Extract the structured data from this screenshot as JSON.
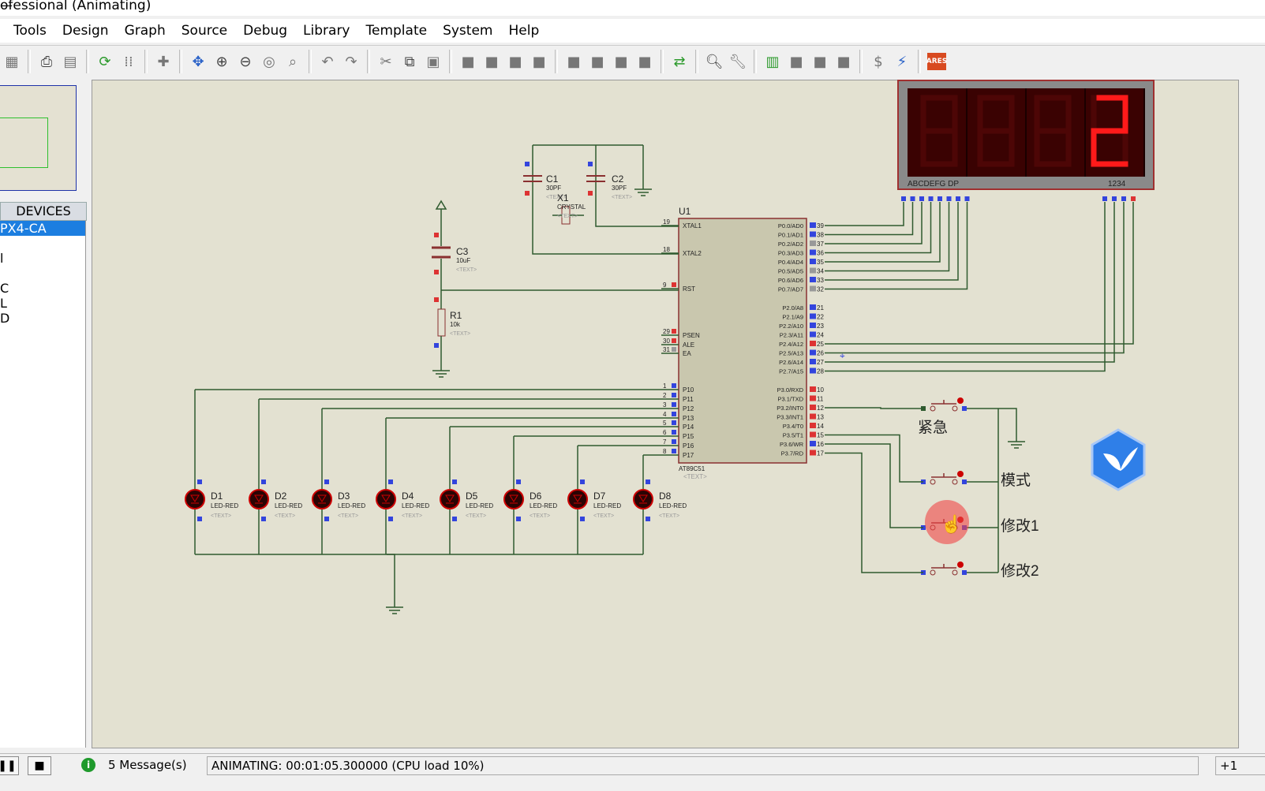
{
  "window": {
    "title": "ofessional (Animating)",
    "minimize_icon": "minimize-icon"
  },
  "menu": [
    "Tools",
    "Design",
    "Graph",
    "Source",
    "Debug",
    "Library",
    "Template",
    "System",
    "Help"
  ],
  "toolbar": {
    "icons": [
      "import-icon",
      "print-icon",
      "page-icon",
      "refresh-icon",
      "grid-icon",
      "origin-icon",
      "pan-icon",
      "zoom-in-icon",
      "zoom-out-icon",
      "zoom-all-icon",
      "zoom-area-icon",
      "undo-icon",
      "redo-icon",
      "cut-icon",
      "copy-icon",
      "paste-icon",
      "block-copy-icon",
      "block-move-icon",
      "block-rotate-icon",
      "block-delete-icon",
      "pick-device-icon",
      "make-device-icon",
      "package-icon",
      "decompose-icon",
      "wire-autorouter-icon",
      "search-icon",
      "property-tool-icon",
      "netlist-icon",
      "new-sheet-icon",
      "remove-sheet-icon",
      "exit-parent-icon",
      "bill-of-materials-icon",
      "electrical-check-icon",
      "ares-icon"
    ],
    "ares_label": "ARES"
  },
  "devices": {
    "header": "DEVICES",
    "items": [
      "PX4-CA",
      "",
      "l",
      "",
      "C",
      "L",
      "D"
    ],
    "selected": 0
  },
  "schematic": {
    "display": {
      "segment_labels": "ABCDEFG  DP",
      "digit_labels": "1234",
      "digits": [
        "",
        "",
        "",
        "2"
      ],
      "lit_color": "#ff1a1a"
    },
    "chip": {
      "ref": "U1",
      "part": "AT89C51",
      "text": "<TEXT>",
      "left_pins": [
        {
          "num": "19",
          "name": "XTAL1"
        },
        {
          "num": "18",
          "name": "XTAL2"
        },
        {
          "num": "9",
          "name": "RST"
        },
        {
          "num": "29",
          "name": "PSEN"
        },
        {
          "num": "30",
          "name": "ALE"
        },
        {
          "num": "31",
          "name": "EA"
        },
        {
          "num": "1",
          "name": "P10"
        },
        {
          "num": "2",
          "name": "P11"
        },
        {
          "num": "3",
          "name": "P12"
        },
        {
          "num": "4",
          "name": "P13"
        },
        {
          "num": "5",
          "name": "P14"
        },
        {
          "num": "6",
          "name": "P15"
        },
        {
          "num": "7",
          "name": "P16"
        },
        {
          "num": "8",
          "name": "P17"
        }
      ],
      "right_pins": [
        {
          "num": "39",
          "name": "P0.0/AD0"
        },
        {
          "num": "38",
          "name": "P0.1/AD1"
        },
        {
          "num": "37",
          "name": "P0.2/AD2"
        },
        {
          "num": "36",
          "name": "P0.3/AD3"
        },
        {
          "num": "35",
          "name": "P0.4/AD4"
        },
        {
          "num": "34",
          "name": "P0.5/AD5"
        },
        {
          "num": "33",
          "name": "P0.6/AD6"
        },
        {
          "num": "32",
          "name": "P0.7/AD7"
        },
        {
          "num": "21",
          "name": "P2.0/A8"
        },
        {
          "num": "22",
          "name": "P2.1/A9"
        },
        {
          "num": "23",
          "name": "P2.2/A10"
        },
        {
          "num": "24",
          "name": "P2.3/A11"
        },
        {
          "num": "25",
          "name": "P2.4/A12"
        },
        {
          "num": "26",
          "name": "P2.5/A13"
        },
        {
          "num": "27",
          "name": "P2.6/A14"
        },
        {
          "num": "28",
          "name": "P2.7/A15"
        },
        {
          "num": "10",
          "name": "P3.0/RXD"
        },
        {
          "num": "11",
          "name": "P3.1/TXD"
        },
        {
          "num": "12",
          "name": "P3.2/INT0"
        },
        {
          "num": "13",
          "name": "P3.3/INT1"
        },
        {
          "num": "14",
          "name": "P3.4/T0"
        },
        {
          "num": "15",
          "name": "P3.5/T1"
        },
        {
          "num": "16",
          "name": "P3.6/WR"
        },
        {
          "num": "17",
          "name": "P3.7/RD"
        }
      ]
    },
    "components": [
      {
        "ref": "C1",
        "value": "30PF",
        "text": "<TEXT>"
      },
      {
        "ref": "C2",
        "value": "30PF",
        "text": "<TEXT>"
      },
      {
        "ref": "X1",
        "value": "CRYSTAL",
        "text": "<TEXT>"
      },
      {
        "ref": "C3",
        "value": "10uF",
        "text": "<TEXT>"
      },
      {
        "ref": "R1",
        "value": "10k",
        "text": "<TEXT>"
      }
    ],
    "leds": [
      {
        "ref": "D1",
        "value": "LED-RED",
        "text": "<TEXT>"
      },
      {
        "ref": "D2",
        "value": "LED-RED",
        "text": "<TEXT>"
      },
      {
        "ref": "D3",
        "value": "LED-RED",
        "text": "<TEXT>"
      },
      {
        "ref": "D4",
        "value": "LED-RED",
        "text": "<TEXT>"
      },
      {
        "ref": "D5",
        "value": "LED-RED",
        "text": "<TEXT>"
      },
      {
        "ref": "D6",
        "value": "LED-RED",
        "text": "<TEXT>"
      },
      {
        "ref": "D7",
        "value": "LED-RED",
        "text": "<TEXT>"
      },
      {
        "ref": "D8",
        "value": "LED-RED",
        "text": "<TEXT>"
      }
    ],
    "buttons": [
      {
        "label": "紧急"
      },
      {
        "label": "模式"
      },
      {
        "label": "修改1"
      },
      {
        "label": "修改2"
      }
    ]
  },
  "status": {
    "pause_icon": "pause-icon",
    "stop_icon": "stop-icon",
    "messages": "5 Message(s)",
    "animating": "ANIMATING: 00:01:05.300000 (CPU load 10%)",
    "zoom": "+1"
  },
  "colors": {
    "canvas": "#e3e1d1",
    "wire": "#2f5a2f",
    "chip": "#c9c7ae",
    "led_red": "#cc0000",
    "selection": "#1c7ee0"
  }
}
